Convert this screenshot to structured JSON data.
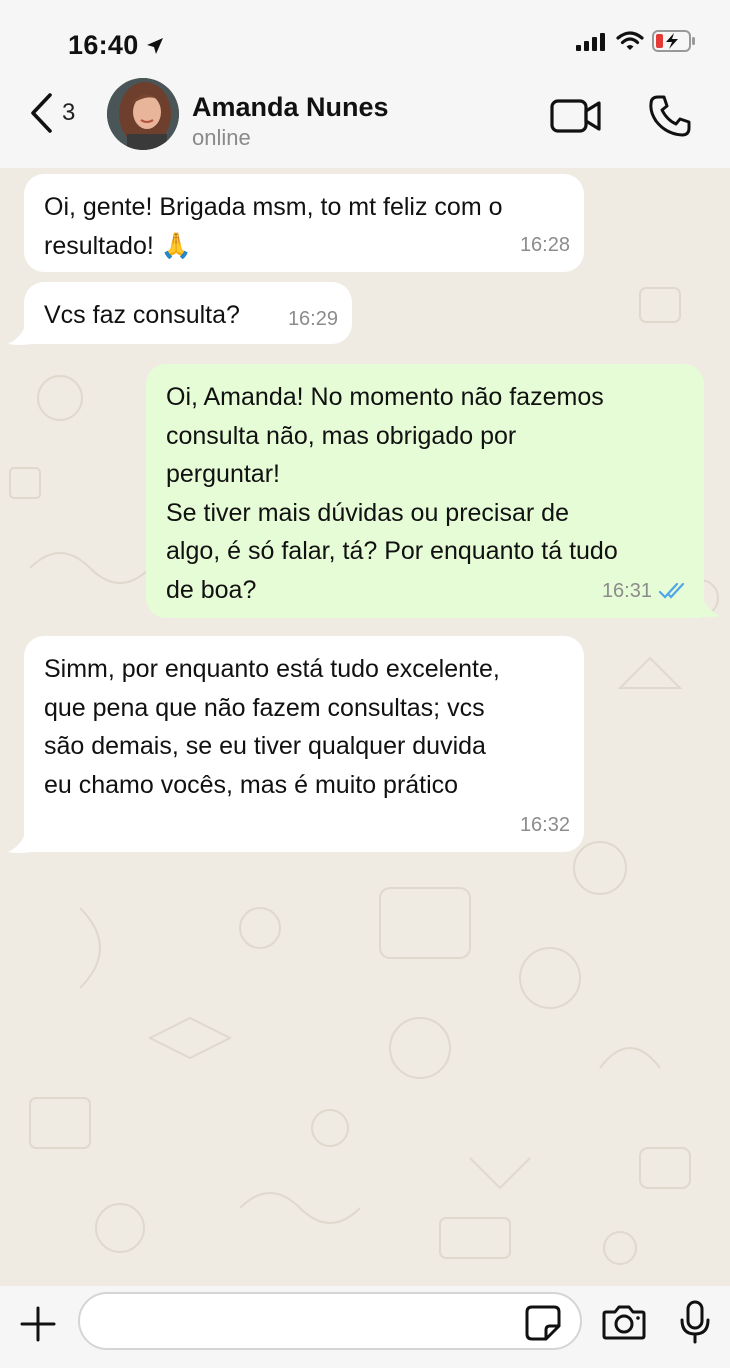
{
  "status_bar": {
    "time": "16:40"
  },
  "header": {
    "back_count": "3",
    "contact_name": "Amanda Nunes",
    "contact_status": "online"
  },
  "messages": [
    {
      "direction": "in",
      "text": "Oi, gente! Brigada msm, to mt feliz com o\nresultado! 🙏",
      "time": "16:28"
    },
    {
      "direction": "in",
      "text": "Vcs faz consulta?",
      "time": "16:29"
    },
    {
      "direction": "out",
      "text": "Oi, Amanda! No momento não fazemos\nconsulta não, mas obrigado por\nperguntar!\nSe tiver mais dúvidas ou precisar de\nalgo, é só falar, tá? Por enquanto tá tudo\nde boa?",
      "time": "16:31",
      "read": true
    },
    {
      "direction": "in",
      "text": "Simm, por enquanto está tudo excelente,\nque pena que não fazem consultas; vcs\nsão demais, se eu tiver qualquer duvida\neu chamo vocês, mas é muito prático",
      "time": "16:32"
    }
  ],
  "composer": {
    "value": "",
    "placeholder": ""
  },
  "colors": {
    "incoming_bubble": "#ffffff",
    "outgoing_bubble": "#e6fcd6",
    "read_ticks": "#4fa6e8",
    "chat_background": "#efeae2"
  },
  "icons": {
    "back": "chevron-left-icon",
    "location": "location-arrow-icon",
    "signal": "signal-icon",
    "wifi": "wifi-icon",
    "battery": "battery-charging-icon",
    "video": "video-camera-icon",
    "call": "phone-icon",
    "plus": "plus-icon",
    "sticker": "sticker-icon",
    "camera": "camera-icon",
    "mic": "microphone-icon",
    "read": "double-check-icon"
  }
}
